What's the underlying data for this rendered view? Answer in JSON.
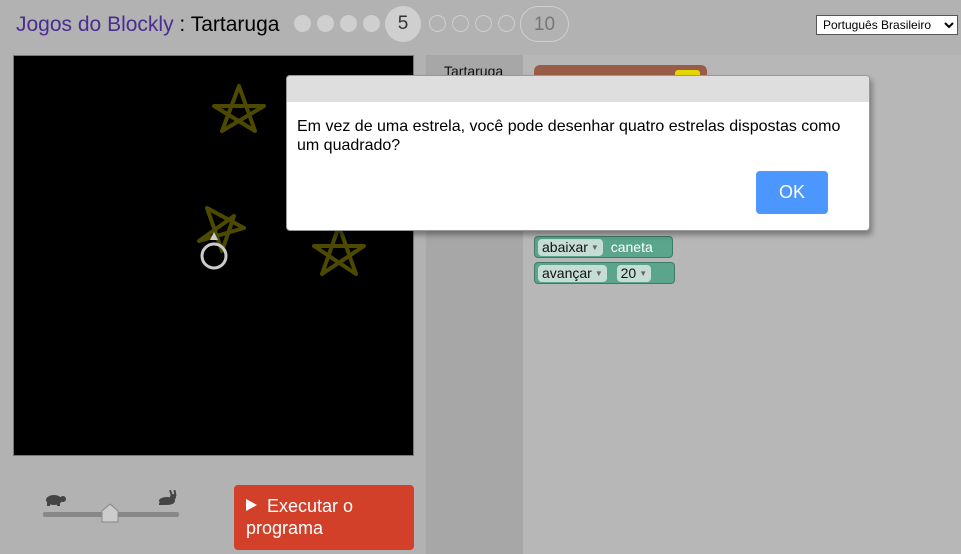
{
  "header": {
    "app_name": "Jogos do Blockly",
    "separator": " : ",
    "game_name": "Tartaruga",
    "current_level": "5",
    "last_level": "10",
    "language": "Português Brasileiro"
  },
  "toolbox": {
    "label": "Tartaruga"
  },
  "blocks": [
    {
      "command": "abaixar",
      "param": "caneta"
    },
    {
      "command": "avançar",
      "value": "20"
    }
  ],
  "dialog": {
    "message": "Em vez de uma estrela, você pode desenhar quatro estrelas dispostas como um quadrado?",
    "ok_label": "OK"
  },
  "run_button": {
    "label": "Executar o programa"
  },
  "colors": {
    "accent_blue": "#4c97ff",
    "run_red": "#d34029",
    "turtle_block_green": "#5ba58c",
    "procedure_brown": "#995d47",
    "title_purple": "#4b2d91",
    "star_olive": "#4d4a00"
  }
}
